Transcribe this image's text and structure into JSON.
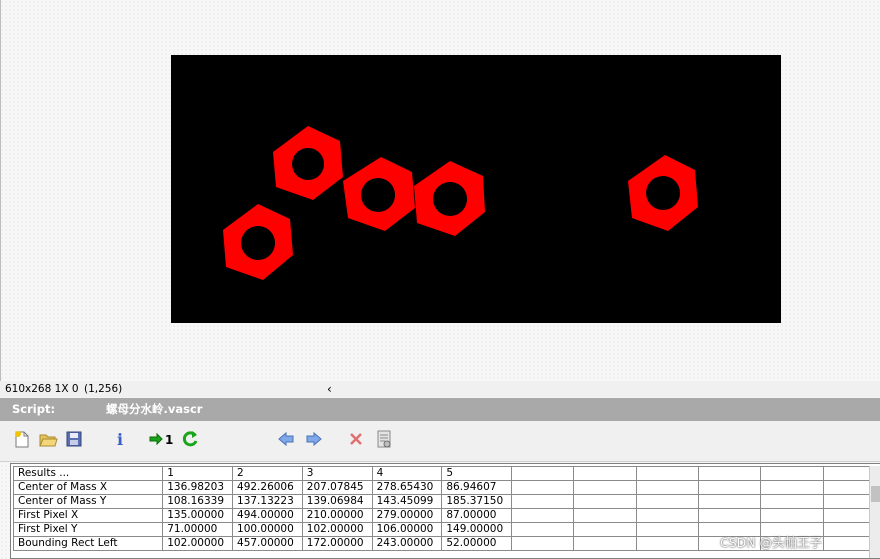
{
  "status": {
    "dimensions": "610x268 1X 0",
    "coordinates": "(1,256)",
    "scroll_arrow": "‹"
  },
  "script_panel": {
    "label": "Script:",
    "filename": "螺母分水岭.vascr"
  },
  "toolbar": {
    "buttons": [
      {
        "name": "new-script-icon",
        "glyph": "📄"
      },
      {
        "name": "open-folder-icon",
        "glyph": "📂"
      },
      {
        "name": "save-disk-icon",
        "glyph": "💾"
      },
      {
        "name": "info-icon",
        "glyph": "i"
      },
      {
        "name": "step-one-icon",
        "glyph": "➡1"
      },
      {
        "name": "run-loop-icon",
        "glyph": "⟳"
      },
      {
        "name": "arrow-left-icon",
        "glyph": "⇦"
      },
      {
        "name": "arrow-right-icon",
        "glyph": "⇨"
      },
      {
        "name": "delete-x-icon",
        "glyph": "✕"
      },
      {
        "name": "properties-icon",
        "glyph": "▤"
      }
    ]
  },
  "results": {
    "header": [
      "Results ...",
      "1",
      "2",
      "3",
      "4",
      "5",
      "",
      "",
      "",
      "",
      "",
      ""
    ],
    "rows": [
      [
        "Center of Mass X",
        "136.98203",
        "492.26006",
        "207.07845",
        "278.65430",
        "86.94607"
      ],
      [
        "Center of Mass Y",
        "108.16339",
        "137.13223",
        "139.06984",
        "143.45099",
        "185.37150"
      ],
      [
        "First Pixel X",
        "135.00000",
        "494.00000",
        "210.00000",
        "279.00000",
        "87.00000"
      ],
      [
        "First Pixel Y",
        "71.00000",
        "100.00000",
        "102.00000",
        "106.00000",
        "149.00000"
      ],
      [
        "Bounding Rect Left",
        "102.00000",
        "457.00000",
        "172.00000",
        "243.00000",
        "52.00000"
      ]
    ]
  },
  "overlay_colors": {
    "canvas_bg": "#000000",
    "object_fill": "#ff0000"
  },
  "watermark": "CSDN @头帕王子"
}
